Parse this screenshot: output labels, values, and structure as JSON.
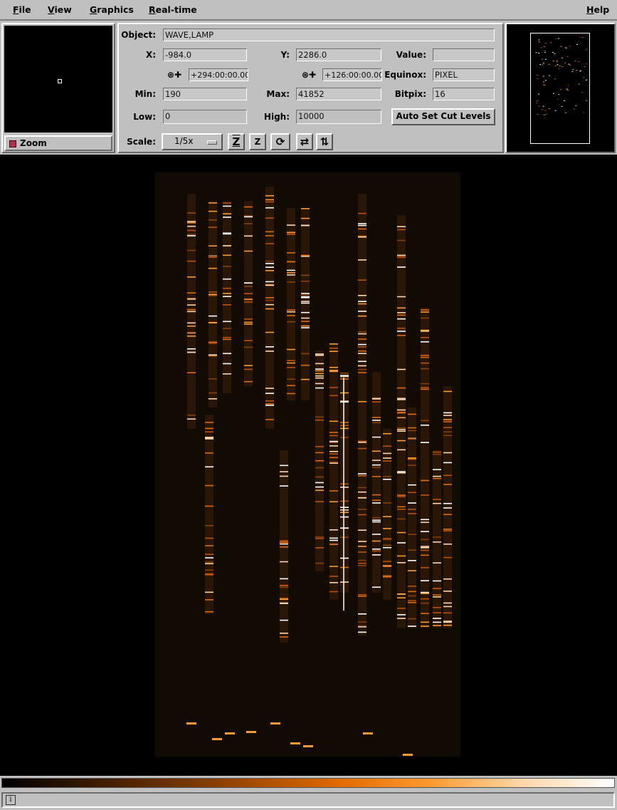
{
  "menu": {
    "file": "File",
    "view": "View",
    "graphics": "Graphics",
    "realtime": "Real-time",
    "help": "Help"
  },
  "zoom": {
    "label": "Zoom",
    "checked": true
  },
  "info": {
    "object_label": "Object:",
    "object_value": "WAVE,LAMP",
    "x_label": "X:",
    "x_value": "-984.0",
    "y_label": "Y:",
    "y_value": "2286.0",
    "value_label": "Value:",
    "value_value": "",
    "ra_value": "+294:00:00.00",
    "dec_value": "+126:00:00.00",
    "equinox_label": "Equinox:",
    "equinox_value": "PIXEL",
    "min_label": "Min:",
    "min_value": "190",
    "max_label": "Max:",
    "max_value": "41852",
    "bitpix_label": "Bitpix:",
    "bitpix_value": "16",
    "low_label": "Low:",
    "low_value": "0",
    "high_label": "High:",
    "high_value": "10000",
    "auto_cut_button": "Auto Set Cut Levels",
    "scale_label": "Scale:",
    "scale_value": "1/5x"
  },
  "toolbar_icons": [
    "zoom-fit-icon",
    "zoom-in-icon",
    "rotate-icon",
    "flip-x-icon",
    "flip-y-icon"
  ],
  "image": {
    "colormap": [
      "#000000",
      "#8a3f00",
      "#e06a00",
      "#ff9a30",
      "#ffffff"
    ]
  },
  "status": {
    "icon": "i",
    "text": ""
  }
}
